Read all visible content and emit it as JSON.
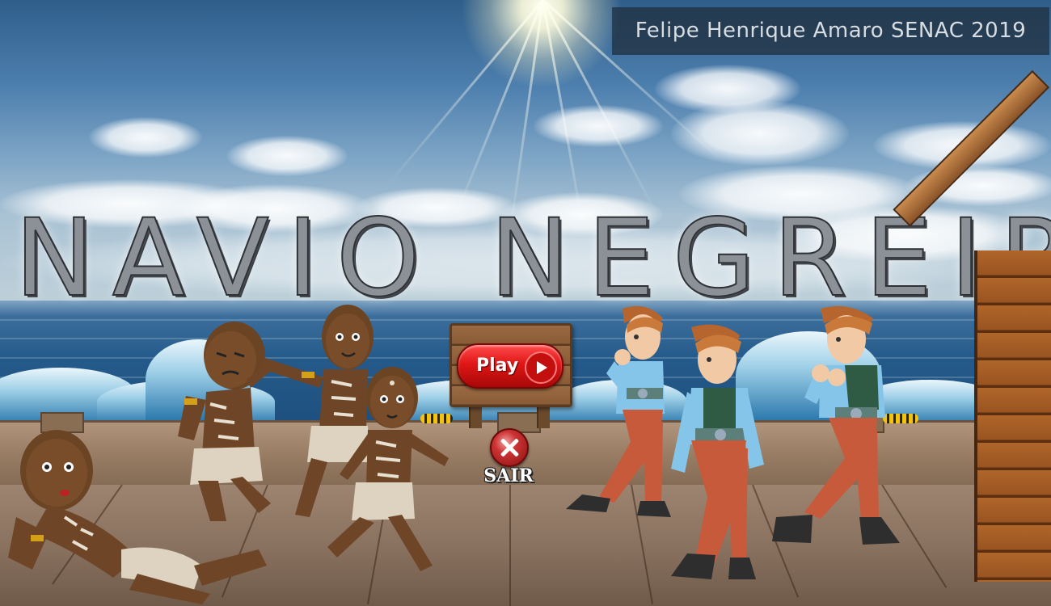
{
  "credit": {
    "text": "Felipe Henrique Amaro SENAC 2019"
  },
  "title": {
    "text": "NAVIO NEGREIRO"
  },
  "menu": {
    "play_label": "Play",
    "exit_label": "SAIR"
  },
  "icons": {
    "play": "play-icon",
    "exit": "close-x-icon"
  },
  "colors": {
    "play_button": "#e01616",
    "exit_button": "#c33333",
    "credit_background": "#1e2c3a",
    "sky": "#4d7fae",
    "sea": "#245a8a",
    "deck": "#8a7260"
  }
}
